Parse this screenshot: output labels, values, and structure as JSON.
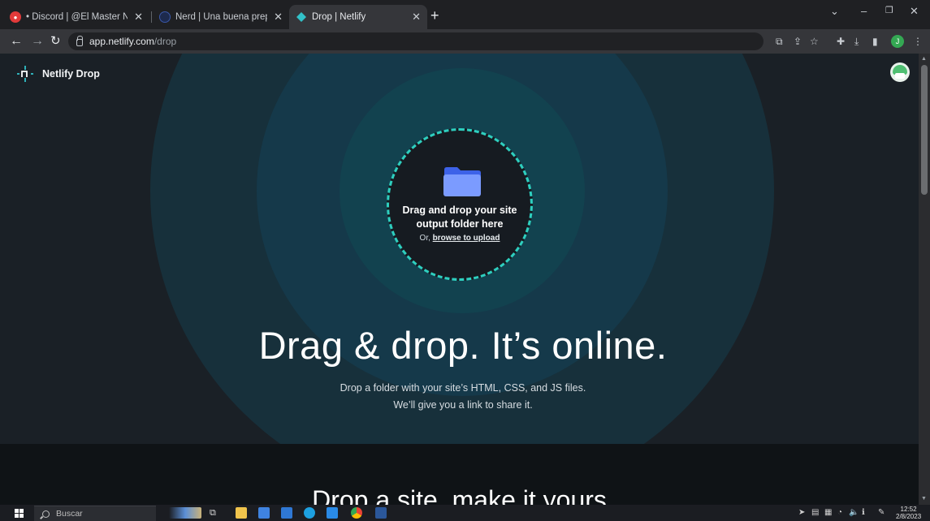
{
  "browser": {
    "tabs": [
      {
        "title": "• Discord | @El Master Nacho",
        "active": false
      },
      {
        "title": "Nerd | Una buena preparación es",
        "active": false
      },
      {
        "title": "Drop | Netlify",
        "active": true
      }
    ],
    "new_tab": "+",
    "url_host": "app.netlify.com",
    "url_path": "/drop",
    "profile_initial": "J"
  },
  "page": {
    "brand": "Netlify Drop",
    "dropzone": {
      "title": "Drag and drop your site output folder here",
      "or_prefix": "Or,",
      "browse_link": "browse to upload"
    },
    "hero_title": "Drag & drop. It’s online.",
    "sub_line1": "Drop a folder with your site’s HTML, CSS, and JS files.",
    "sub_line2": "We’ll give you a link to share it.",
    "section_title": "Drop a site, make it yours"
  },
  "taskbar": {
    "search_placeholder": "Buscar",
    "time": "12:52",
    "date": "2/8/2023"
  },
  "colors": {
    "accent": "#2ecfbf",
    "background": "#1a2026",
    "folder": "#6b8cff"
  }
}
